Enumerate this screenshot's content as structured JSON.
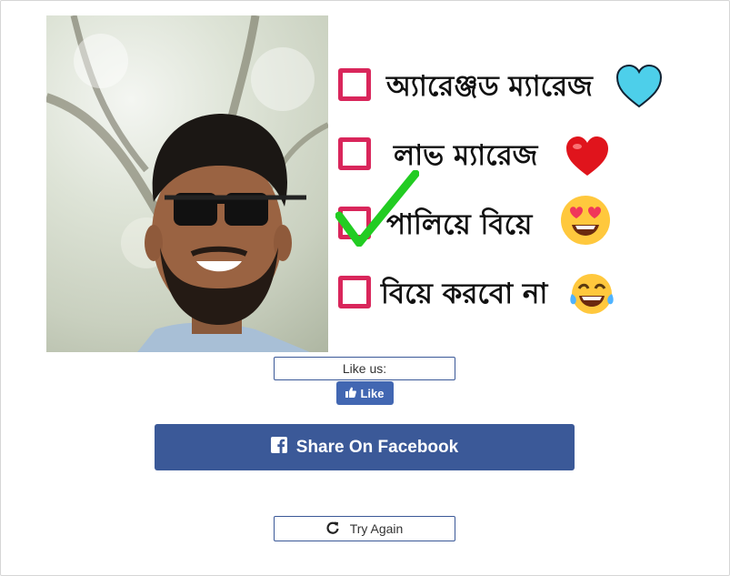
{
  "result": {
    "options": [
      {
        "label": "অ্যারেঞ্জড ম্যারেজ",
        "checked": false,
        "emoji": "blue-heart-icon"
      },
      {
        "label": "লাভ ম্যারেজ",
        "checked": false,
        "emoji": "red-heart-icon"
      },
      {
        "label": "পালিয়ে বিয়ে",
        "checked": true,
        "emoji": "heart-eyes-face-icon"
      },
      {
        "label": "বিয়ে করবো না",
        "checked": false,
        "emoji": "tears-of-joy-face-icon"
      }
    ],
    "colors": {
      "checkbox_border": "#d9265b",
      "checkmark": "#22cc22"
    }
  },
  "like": {
    "box_label": "Like us:",
    "button_label": "Like"
  },
  "share": {
    "label": "Share On Facebook",
    "color": "#3b5998"
  },
  "try_again": {
    "label": "Try Again"
  }
}
